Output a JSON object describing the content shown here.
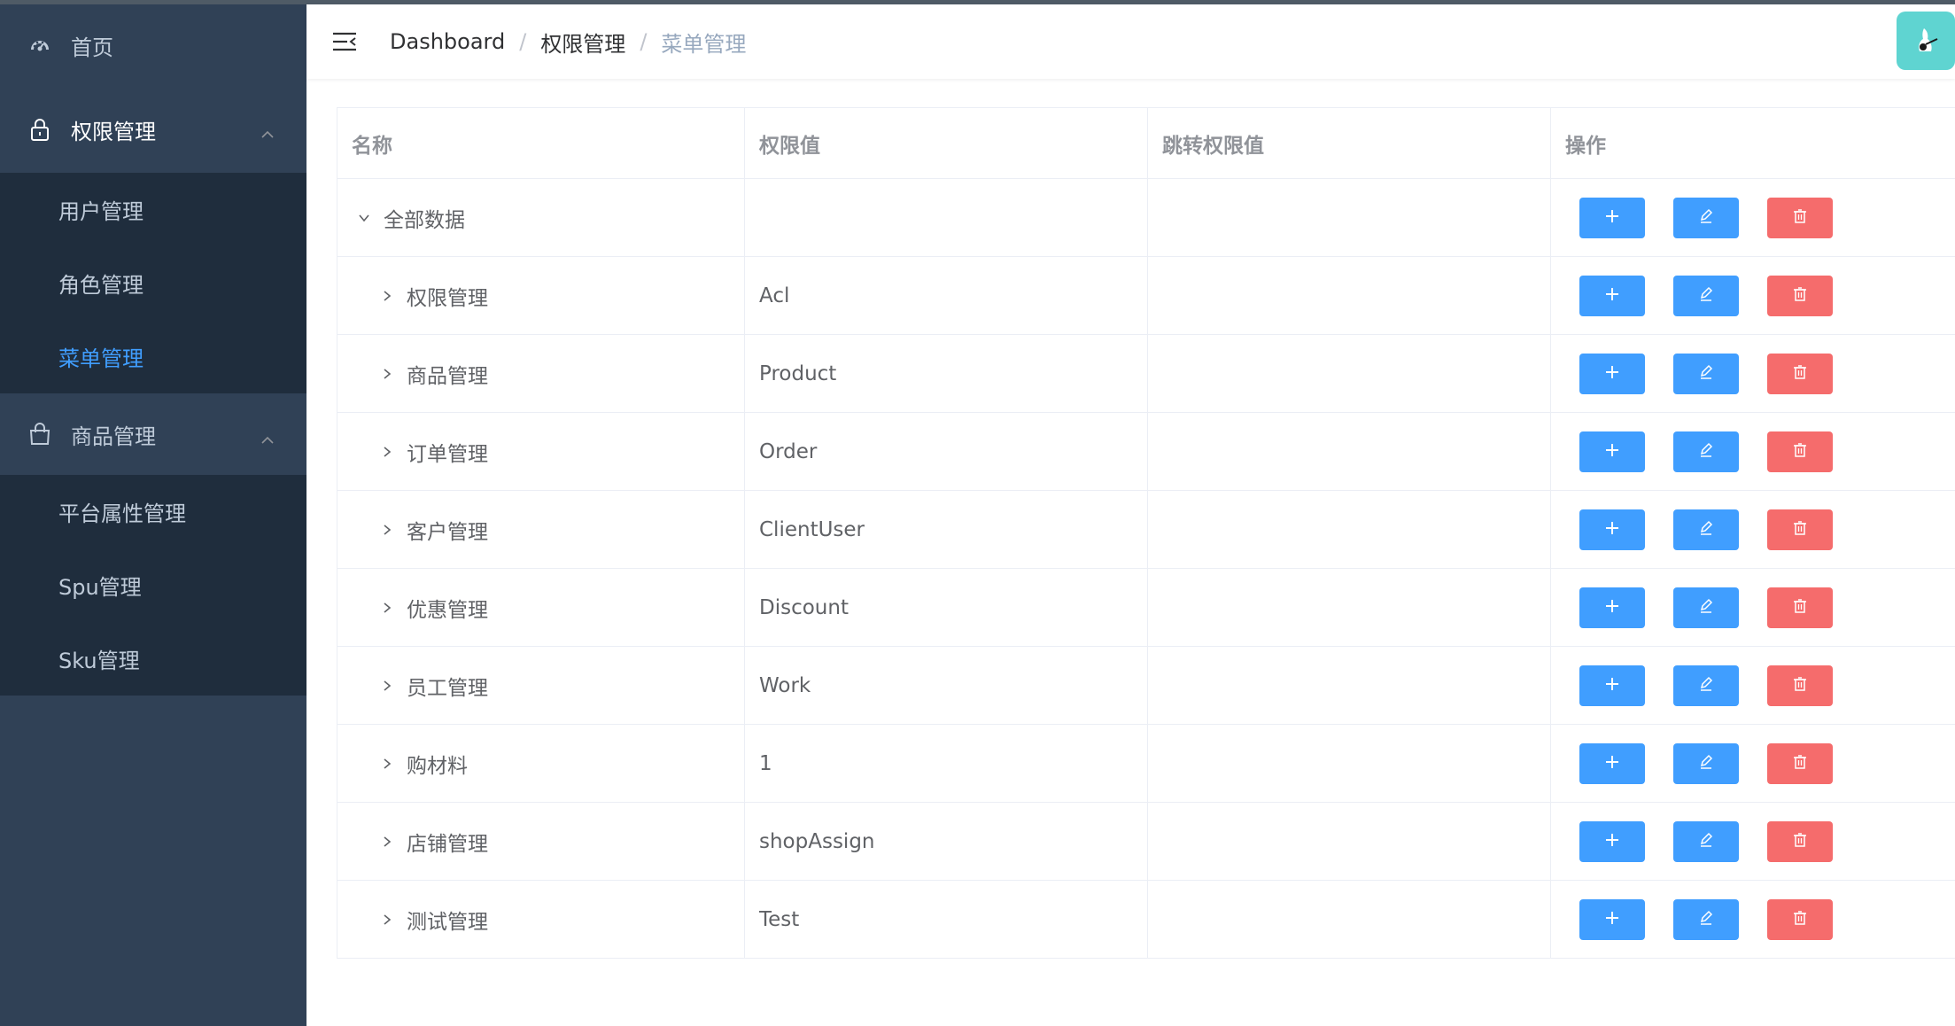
{
  "sidebar": {
    "home": "首页",
    "permission_group": "权限管理",
    "permission_items": [
      "用户管理",
      "角色管理",
      "菜单管理"
    ],
    "product_group": "商品管理",
    "product_items": [
      "平台属性管理",
      "Spu管理",
      "Sku管理"
    ]
  },
  "header": {
    "breadcrumb": [
      "Dashboard",
      "权限管理",
      "菜单管理"
    ],
    "separator": "/"
  },
  "table": {
    "columns": [
      "名称",
      "权限值",
      "跳转权限值",
      "操作"
    ],
    "root": {
      "name": "全部数据",
      "value": "",
      "to_code": ""
    },
    "rows": [
      {
        "name": "权限管理",
        "value": "Acl",
        "to_code": ""
      },
      {
        "name": "商品管理",
        "value": "Product",
        "to_code": ""
      },
      {
        "name": "订单管理",
        "value": "Order",
        "to_code": ""
      },
      {
        "name": "客户管理",
        "value": "ClientUser",
        "to_code": ""
      },
      {
        "name": "优惠管理",
        "value": "Discount",
        "to_code": ""
      },
      {
        "name": "员工管理",
        "value": "Work",
        "to_code": ""
      },
      {
        "name": "购材料",
        "value": "1",
        "to_code": ""
      },
      {
        "name": "店铺管理",
        "value": "shopAssign",
        "to_code": ""
      },
      {
        "name": "测试管理",
        "value": "Test",
        "to_code": ""
      }
    ]
  },
  "colors": {
    "sidebar_bg": "#304156",
    "submenu_bg": "#1f2d3d",
    "active": "#409eff",
    "danger": "#f56c6c",
    "avatar_bg": "#5fd4d1"
  }
}
